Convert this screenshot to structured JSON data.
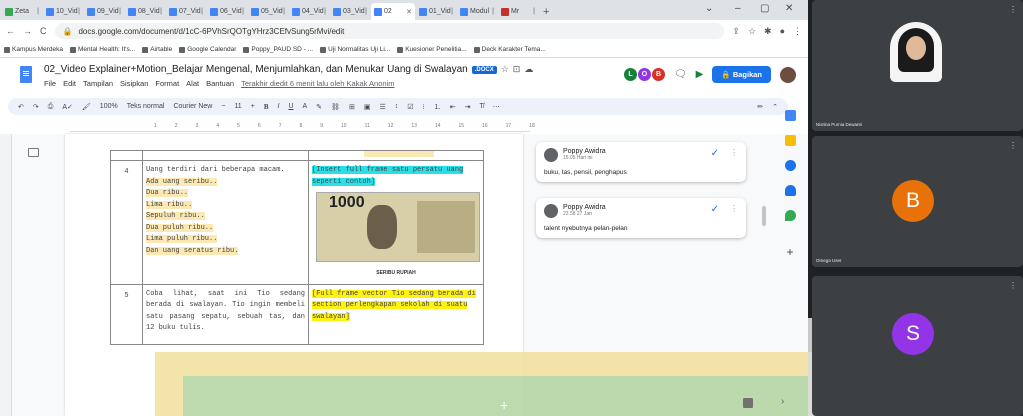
{
  "tabs": [
    {
      "label": "Zeta",
      "fav": "drive"
    },
    {
      "label": "10_Vid",
      "fav": "docs"
    },
    {
      "label": "09_Vid",
      "fav": "docs"
    },
    {
      "label": "08_Vid",
      "fav": "docs"
    },
    {
      "label": "07_Vid",
      "fav": "docs"
    },
    {
      "label": "06_Vid",
      "fav": "docs"
    },
    {
      "label": "05_Vid",
      "fav": "docs"
    },
    {
      "label": "04_Vid",
      "fav": "docs"
    },
    {
      "label": "03_Vid",
      "fav": "docs"
    },
    {
      "label": "02",
      "fav": "docs",
      "active": true
    },
    {
      "label": "01_Vid",
      "fav": "docs"
    },
    {
      "label": "Modul",
      "fav": "docs"
    },
    {
      "label": "Mr",
      "fav": "yt"
    }
  ],
  "address": {
    "url": "docs.google.com/document/d/1cC-6PVhSrQOTgYHrz3CEfvSung5rMvi/edit"
  },
  "bookmarks": [
    "Kampus Merdeka",
    "Mental Health: It's...",
    "Airtable",
    "Google Calendar",
    "Poppy_PAUD SD - ...",
    "Uji Normalitas Uji Li...",
    "Kuesioner Penelitia...",
    "Deck Karakter Tema..."
  ],
  "doc": {
    "title": "02_Video Explainer+Motion_Belajar Mengenal, Menjumlahkan, dan Menukar Uang di Swalayan",
    "badge": ".DOCX",
    "menus": [
      "File",
      "Edit",
      "Tampilan",
      "Sisipkan",
      "Format",
      "Alat",
      "Bantuan"
    ],
    "last_edit": "Terakhir diedit 6 menit lalu oleh Kakak Anonim",
    "share": "Bagikan"
  },
  "toolbar": {
    "zoom": "100%",
    "style": "Teks normal",
    "font": "Courier New",
    "size": "11"
  },
  "table": {
    "row4": {
      "no": "4",
      "line1": "Uang terdiri dari beberapa macam.",
      "items": [
        "Ada uang seribu..",
        "Dua ribu..",
        "Lima ribu..",
        "Sepuluh ribu..",
        "Dua puluh ribu..",
        "Lima puluh ribu..",
        "Dan uang seratus ribu."
      ],
      "visual": "[Insert full frame satu persatu uang seperti contoh]",
      "money_num": "1000",
      "money_caption": "SERIBU RUPIAH"
    },
    "row5": {
      "no": "5",
      "text": "Coba lihat, saat ini Tio sedang berada di swalayan. Tio ingin membeli satu pasang sepatu, sebuah tas, dan 12 buku tulis.",
      "visual": "[Full frame vector Tio sedang berada di section perlengkapan sekolah di suatu swalayan]"
    }
  },
  "comments": [
    {
      "name": "Poppy Awidra",
      "time": "15.05 Hari ini",
      "body": "buku, tas, pensil, penghapus"
    },
    {
      "name": "Poppy Awidra",
      "time": "23.58 27 Jan",
      "body": "talent nyebutnya pelan-pelan"
    }
  ],
  "meet": {
    "tiles": [
      {
        "name": "Nisrina Purnia Dewanti",
        "kind": "video"
      },
      {
        "name": "Omega User",
        "letter": "B",
        "color": "#e8710a"
      },
      {
        "name": "",
        "letter": "S",
        "color": "#9334e6"
      }
    ]
  },
  "colors": {
    "accent": "#1a73e8",
    "highlight_cyan": "#2ae0e8",
    "highlight_yellow": "#fff212",
    "highlight_orange": "#fce8b2"
  }
}
